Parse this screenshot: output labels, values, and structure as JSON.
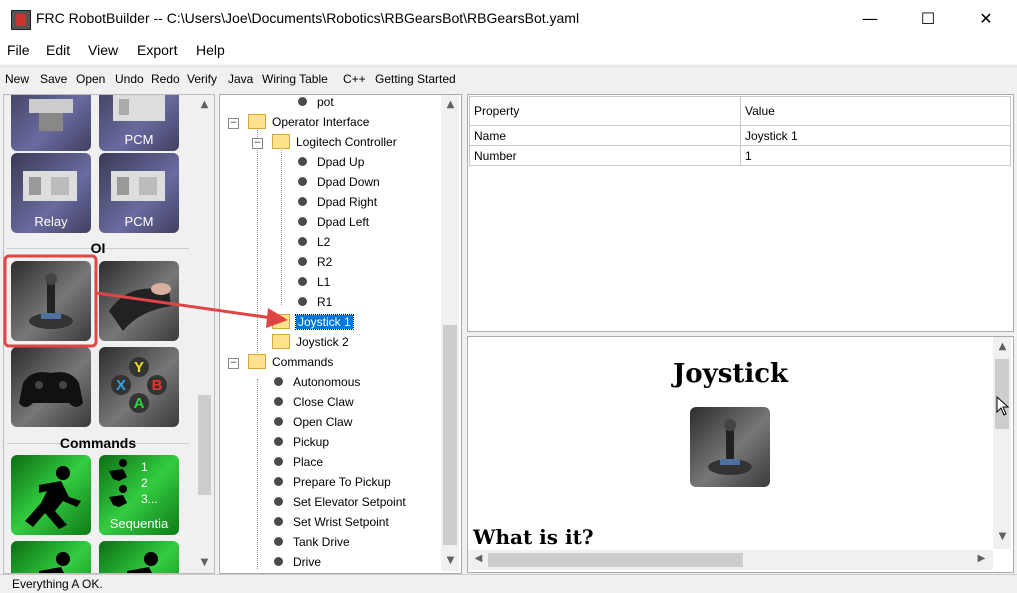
{
  "window": {
    "title": "FRC RobotBuilder -- C:\\Users\\Joe\\Documents\\Robotics\\RBGearsBot\\RBGearsBot.yaml",
    "minimize_glyph": "—",
    "maximize_glyph": "☐",
    "close_glyph": "✕"
  },
  "menu": [
    "File",
    "Edit",
    "View",
    "Export",
    "Help"
  ],
  "toolbar": [
    "New",
    "Save",
    "Open",
    "Undo",
    "Redo",
    "Verify",
    "Java",
    "Wiring Table",
    "C++",
    "Getting Started"
  ],
  "palette": {
    "tiles_top": [
      {
        "label": "",
        "icon": "solenoid-icon"
      },
      {
        "label": "PCM",
        "icon": "pcm-icon"
      },
      {
        "label": "Relay",
        "icon": "relay-icon"
      },
      {
        "label": "PCM",
        "icon": "pcm-icon"
      }
    ],
    "oi_label": "OI",
    "oi_tiles": [
      {
        "label": "",
        "icon": "joystick-icon"
      },
      {
        "label": "",
        "icon": "joystick-button-icon"
      },
      {
        "label": "",
        "icon": "gamepad-icon"
      },
      {
        "label": "",
        "icon": "gamepad-buttons-icon"
      }
    ],
    "gamepad_buttons": [
      "Y",
      "X",
      "B",
      "A"
    ],
    "commands_label": "Commands",
    "command_tiles": [
      {
        "label": "",
        "icon": "command-icon"
      },
      {
        "label": "Sequentia",
        "icon": "command-group-icon",
        "lines": [
          "1",
          "2",
          "3..."
        ]
      },
      {
        "label": "",
        "icon": "command-icon"
      },
      {
        "label": "",
        "icon": "command-icon"
      }
    ]
  },
  "tree": {
    "rows": [
      {
        "label": "pot",
        "type": "leaf",
        "level": 3
      },
      {
        "label": "Operator Interface",
        "type": "folder",
        "level": 1,
        "expanded": true
      },
      {
        "label": "Logitech Controller",
        "type": "folder",
        "level": 2,
        "expanded": true
      },
      {
        "label": "Dpad Up",
        "type": "leaf",
        "level": 3
      },
      {
        "label": "Dpad Down",
        "type": "leaf",
        "level": 3
      },
      {
        "label": "Dpad Right",
        "type": "leaf",
        "level": 3
      },
      {
        "label": "Dpad Left",
        "type": "leaf",
        "level": 3
      },
      {
        "label": "L2",
        "type": "leaf",
        "level": 3
      },
      {
        "label": "R2",
        "type": "leaf",
        "level": 3
      },
      {
        "label": "L1",
        "type": "leaf",
        "level": 3
      },
      {
        "label": "R1",
        "type": "leaf",
        "level": 3
      },
      {
        "label": "Joystick 1",
        "type": "folder",
        "level": 2,
        "selected": true
      },
      {
        "label": "Joystick 2",
        "type": "folder",
        "level": 2
      },
      {
        "label": "Commands",
        "type": "folder",
        "level": 1,
        "expanded": true
      },
      {
        "label": "Autonomous",
        "type": "leaf",
        "level": 2
      },
      {
        "label": "Close Claw",
        "type": "leaf",
        "level": 2
      },
      {
        "label": "Open Claw",
        "type": "leaf",
        "level": 2
      },
      {
        "label": "Pickup",
        "type": "leaf",
        "level": 2
      },
      {
        "label": "Place",
        "type": "leaf",
        "level": 2
      },
      {
        "label": "Prepare To Pickup",
        "type": "leaf",
        "level": 2
      },
      {
        "label": "Set Elevator Setpoint",
        "type": "leaf",
        "level": 2
      },
      {
        "label": "Set Wrist Setpoint",
        "type": "leaf",
        "level": 2
      },
      {
        "label": "Tank Drive",
        "type": "leaf",
        "level": 2
      },
      {
        "label": "Drive",
        "type": "leaf",
        "level": 2
      }
    ]
  },
  "properties": {
    "headers": {
      "property": "Property",
      "value": "Value"
    },
    "rows": [
      {
        "name": "Name",
        "value": "Joystick 1"
      },
      {
        "name": "Number",
        "value": "1"
      }
    ]
  },
  "help": {
    "title": "Joystick",
    "heading": "What is it?"
  },
  "status": {
    "text": "Everything A OK."
  },
  "colors": {
    "highlight_box": "#e04545",
    "selection": "#0078d7",
    "arrow": "#e04545"
  }
}
